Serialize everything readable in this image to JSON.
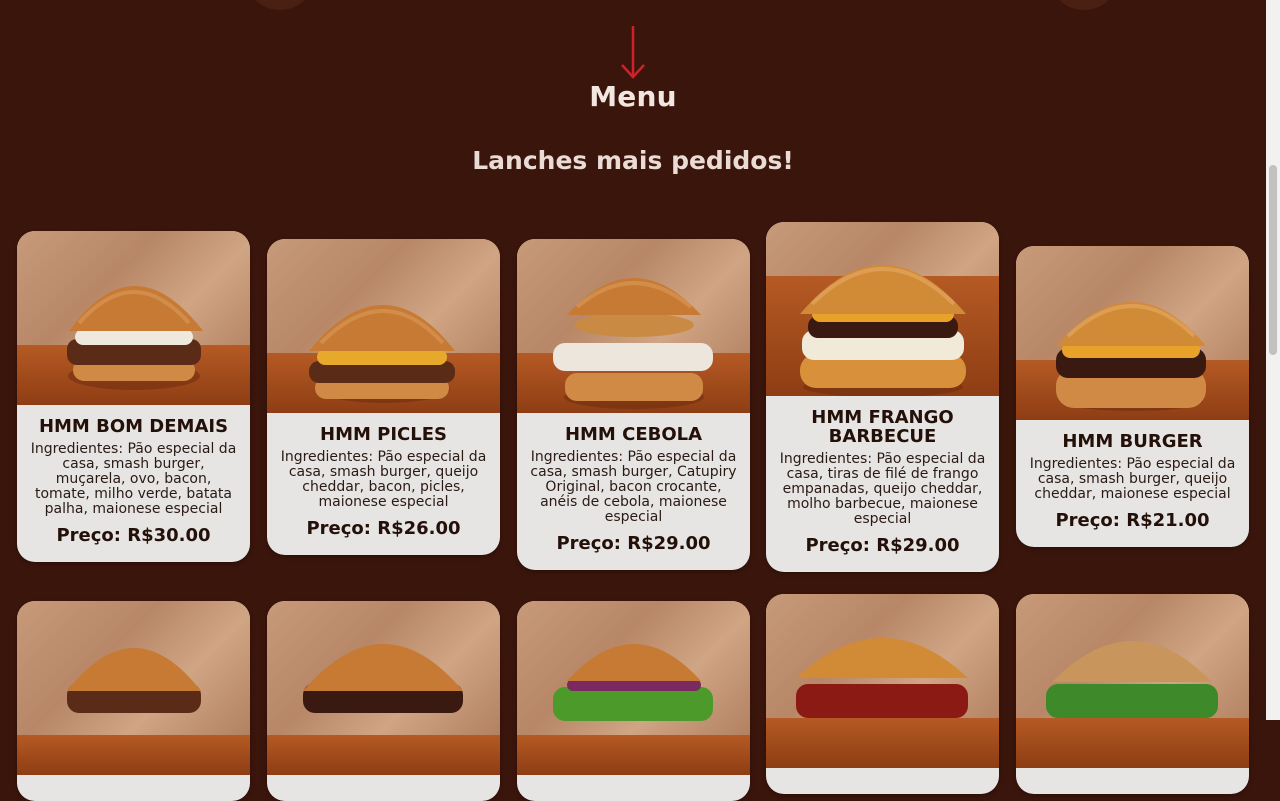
{
  "header": {
    "menu_label": "Menu",
    "section_title": "Lanches mais pedidos!"
  },
  "colors": {
    "background": "#3a150b",
    "card": "#e7e5e4",
    "arrow": "#d0202a"
  },
  "icons": {
    "arrow": "arrow-down-icon"
  },
  "products": [
    {
      "name": "HMM BOM DEMAIS",
      "ingredients": "Ingredientes: Pão especial da casa, smash burger, muçarela, ovo, bacon, tomate, milho verde, batata palha, maionese especial",
      "price": "Preço: R$30.00"
    },
    {
      "name": "HMM PICLES",
      "ingredients": "Ingredientes: Pão especial da casa, smash burger, queijo cheddar, bacon, picles, maionese especial",
      "price": "Preço: R$26.00"
    },
    {
      "name": "HMM CEBOLA",
      "ingredients": "Ingredientes: Pão especial da casa, smash burger, Catupiry Original, bacon crocante, anéis de cebola, maionese especial",
      "price": "Preço: R$29.00"
    },
    {
      "name": "HMM FRANGO BARBECUE",
      "ingredients": "Ingredientes: Pão especial da casa, tiras de filé de frango empanadas, queijo cheddar, molho barbecue, maionese especial",
      "price": "Preço: R$29.00"
    },
    {
      "name": "HMM BURGER",
      "ingredients": "Ingredientes: Pão especial da casa, smash burger, queijo cheddar, maionese especial",
      "price": "Preço: R$21.00"
    }
  ]
}
